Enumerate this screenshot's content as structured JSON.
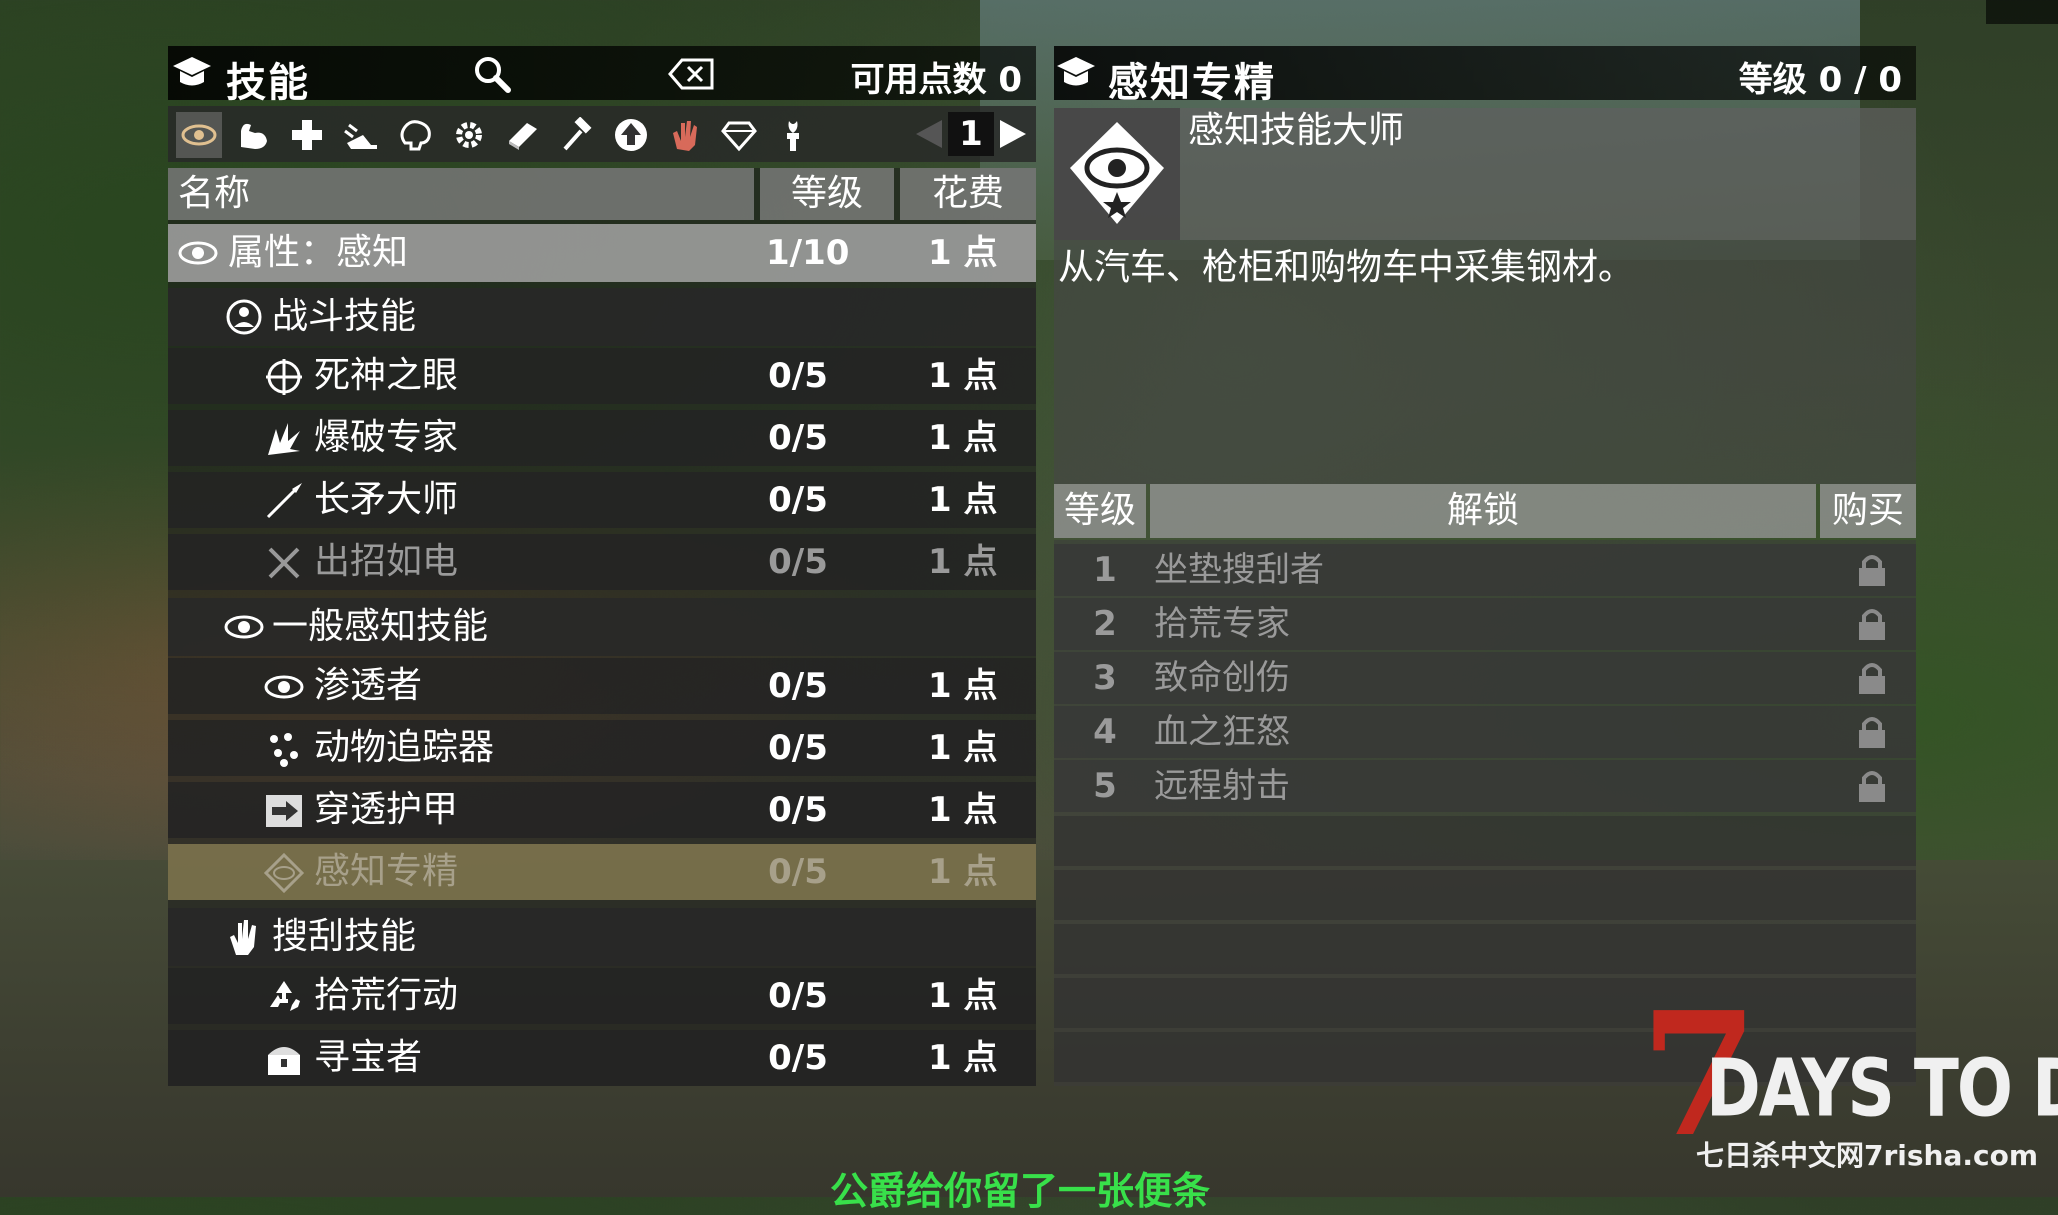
{
  "left_panel": {
    "title": "技能",
    "points_label": "可用点数",
    "points_value": "0",
    "page_number": "1",
    "tabs": [
      "eye-icon",
      "arm-icon",
      "plus-icon",
      "running-icon",
      "brain-icon",
      "gear-icon",
      "book-icon",
      "hammer-icon",
      "tree-icon",
      "hand-icon",
      "diamond-icon",
      "torch-icon"
    ],
    "columns": {
      "name": "名称",
      "level": "等级",
      "cost": "花费"
    },
    "attribute_row": {
      "name": "属性：感知",
      "level": "1/10",
      "cost": "1 点"
    },
    "groups": [
      {
        "name": "战斗技能",
        "skills": [
          {
            "name": "死神之眼",
            "level": "0/5",
            "cost": "1 点",
            "state": "normal"
          },
          {
            "name": "爆破专家",
            "level": "0/5",
            "cost": "1 点",
            "state": "normal"
          },
          {
            "name": "长矛大师",
            "level": "0/5",
            "cost": "1 点",
            "state": "normal"
          },
          {
            "name": "出招如电",
            "level": "0/5",
            "cost": "1 点",
            "state": "dim"
          }
        ]
      },
      {
        "name": "一般感知技能",
        "skills": [
          {
            "name": "渗透者",
            "level": "0/5",
            "cost": "1 点",
            "state": "normal"
          },
          {
            "name": "动物追踪器",
            "level": "0/5",
            "cost": "1 点",
            "state": "normal"
          },
          {
            "name": "穿透护甲",
            "level": "0/5",
            "cost": "1 点",
            "state": "normal"
          },
          {
            "name": "感知专精",
            "level": "0/5",
            "cost": "1 点",
            "state": "selected"
          }
        ]
      },
      {
        "name": "搜刮技能",
        "skills": [
          {
            "name": "拾荒行动",
            "level": "0/5",
            "cost": "1 点",
            "state": "normal"
          },
          {
            "name": "寻宝者",
            "level": "0/5",
            "cost": "1 点",
            "state": "normal"
          }
        ]
      }
    ]
  },
  "right_panel": {
    "title": "感知专精",
    "level_label": "等级",
    "level_value": "0 / 0",
    "perk_name": "感知技能大师",
    "description": "从汽车、枪柜和购物车中采集钢材。",
    "columns": {
      "level": "等级",
      "unlock": "解锁",
      "buy": "购买"
    },
    "levels": [
      {
        "n": "1",
        "unlock": "坐垫搜刮者"
      },
      {
        "n": "2",
        "unlock": "拾荒专家"
      },
      {
        "n": "3",
        "unlock": "致命创伤"
      },
      {
        "n": "4",
        "unlock": "血之狂怒"
      },
      {
        "n": "5",
        "unlock": "远程射击"
      }
    ]
  },
  "subtitle": "公爵给你留了一张便条",
  "logo": {
    "line1": "DAYS TO DIE",
    "line2": "七日杀中文网7risha.com",
    "number": "7"
  },
  "colors": {
    "accent_red": "#c0281e",
    "selected_row": "#827850",
    "subtitle_green": "#38e04a"
  }
}
